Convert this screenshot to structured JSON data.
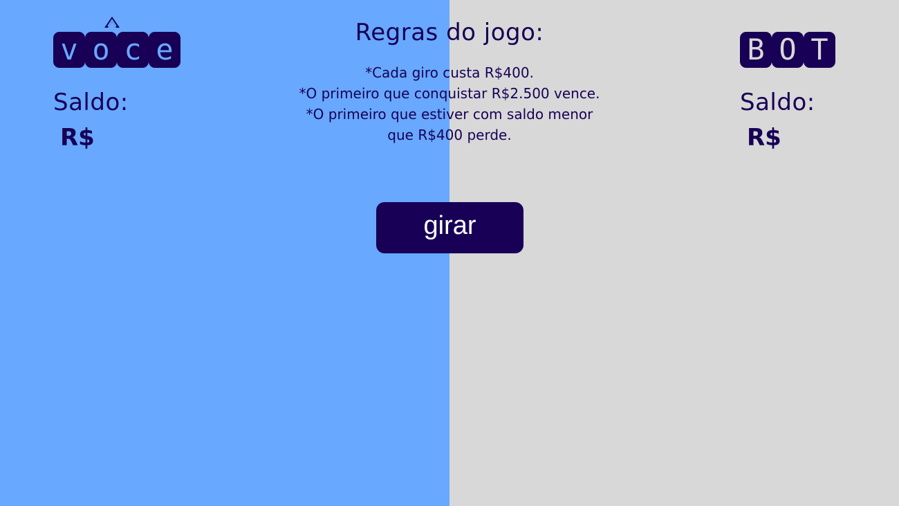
{
  "player": {
    "logo_letters": [
      "v",
      "o",
      "c",
      "e"
    ],
    "logo_text": "você",
    "balance_label": "Saldo:",
    "balance_value": "R$"
  },
  "bot": {
    "logo_letters": [
      "B",
      "O",
      "T"
    ],
    "logo_text": "BOT",
    "balance_label": "Saldo:",
    "balance_value": "R$"
  },
  "rules": {
    "title": "Regras do jogo:",
    "lines": [
      "*Cada giro custa R$400.",
      "*O primeiro que conquistar R$2.500 vence.",
      "*O primeiro que estiver com saldo menor",
      "que R$400 perde."
    ]
  },
  "controls": {
    "spin_label": "girar"
  },
  "colors": {
    "player_panel": "#68a8ff",
    "bot_panel": "#d8d8d8",
    "accent_dark": "#170055",
    "button_text": "#ffffff"
  }
}
